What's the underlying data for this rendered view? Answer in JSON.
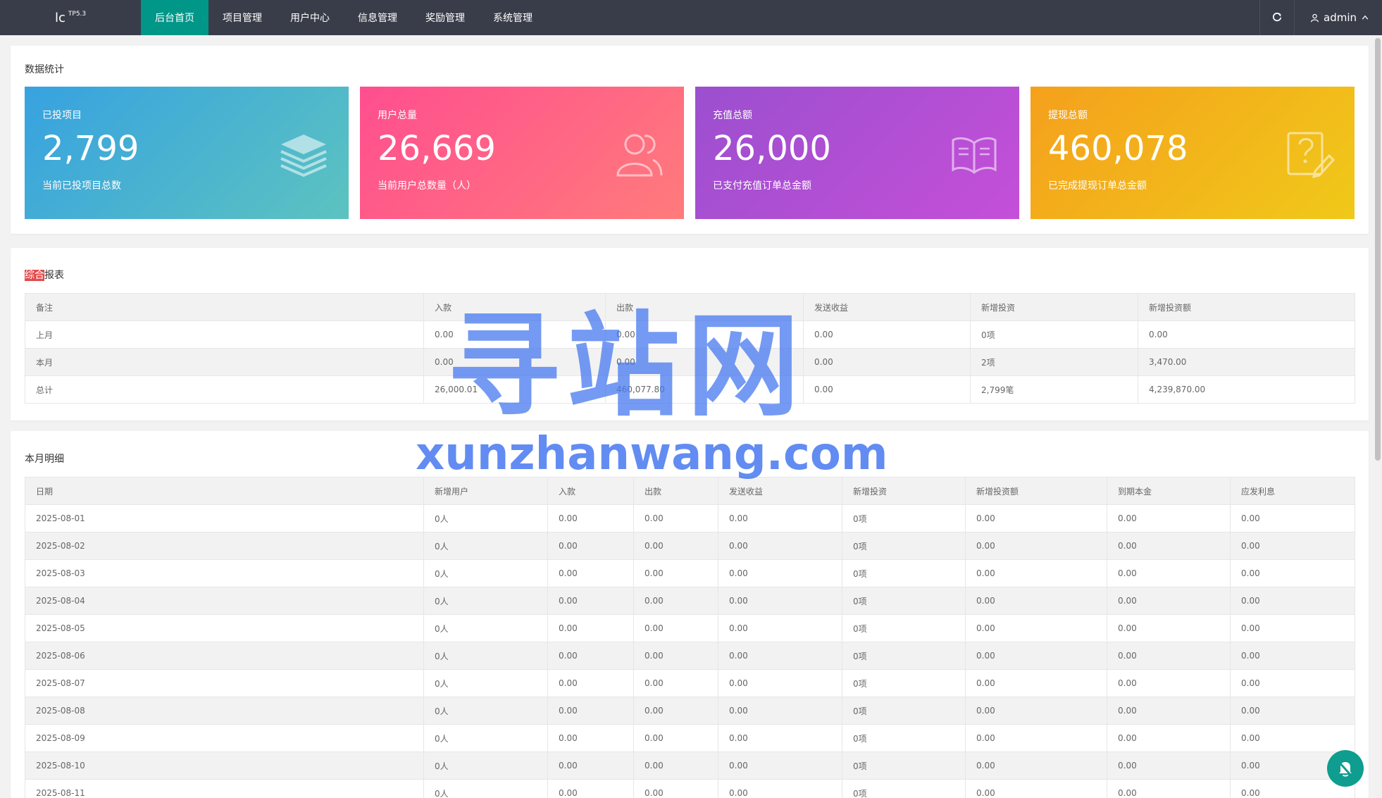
{
  "header": {
    "logo": "lc",
    "logo_sup": "TP5.3",
    "nav": [
      "后台首页",
      "项目管理",
      "用户中心",
      "信息管理",
      "奖励管理",
      "系统管理"
    ],
    "user": "admin"
  },
  "stats": {
    "title": "数据统计",
    "cards": [
      {
        "label": "已投项目",
        "value": "2,799",
        "desc": "当前已投项目总数",
        "icon": "layers-icon"
      },
      {
        "label": "用户总量",
        "value": "26,669",
        "desc": "当前用户总数量（人）",
        "icon": "users-icon"
      },
      {
        "label": "充值总额",
        "value": "26,000",
        "desc": "已支付充值订单总金额",
        "icon": "book-icon"
      },
      {
        "label": "提现总额",
        "value": "460,078",
        "desc": "已完成提现订单总金额",
        "icon": "question-edit-icon"
      }
    ]
  },
  "report": {
    "title_highlight": "综合",
    "title_rest": "报表",
    "headers": [
      "备注",
      "入款",
      "出款",
      "发送收益",
      "新增投资",
      "新增投资额"
    ],
    "rows": [
      [
        "上月",
        "0.00",
        "0.00",
        "0.00",
        "0项",
        "0.00"
      ],
      [
        "本月",
        "0.00",
        "0.00",
        "0.00",
        "2项",
        "3,470.00"
      ],
      [
        "总计",
        "26,000.01",
        "460,077.80",
        "0.00",
        "2,799笔",
        "4,239,870.00"
      ]
    ]
  },
  "monthly": {
    "title": "本月明细",
    "headers": [
      "日期",
      "新增用户",
      "入款",
      "出款",
      "发送收益",
      "新增投资",
      "新增投资额",
      "到期本金",
      "应发利息"
    ],
    "rows": [
      [
        "2025-08-01",
        "0人",
        "0.00",
        "0.00",
        "0.00",
        "0项",
        "0.00",
        "0.00",
        "0.00"
      ],
      [
        "2025-08-02",
        "0人",
        "0.00",
        "0.00",
        "0.00",
        "0项",
        "0.00",
        "0.00",
        "0.00"
      ],
      [
        "2025-08-03",
        "0人",
        "0.00",
        "0.00",
        "0.00",
        "0项",
        "0.00",
        "0.00",
        "0.00"
      ],
      [
        "2025-08-04",
        "0人",
        "0.00",
        "0.00",
        "0.00",
        "0项",
        "0.00",
        "0.00",
        "0.00"
      ],
      [
        "2025-08-05",
        "0人",
        "0.00",
        "0.00",
        "0.00",
        "0项",
        "0.00",
        "0.00",
        "0.00"
      ],
      [
        "2025-08-06",
        "0人",
        "0.00",
        "0.00",
        "0.00",
        "0项",
        "0.00",
        "0.00",
        "0.00"
      ],
      [
        "2025-08-07",
        "0人",
        "0.00",
        "0.00",
        "0.00",
        "0项",
        "0.00",
        "0.00",
        "0.00"
      ],
      [
        "2025-08-08",
        "0人",
        "0.00",
        "0.00",
        "0.00",
        "0项",
        "0.00",
        "0.00",
        "0.00"
      ],
      [
        "2025-08-09",
        "0人",
        "0.00",
        "0.00",
        "0.00",
        "0项",
        "0.00",
        "0.00",
        "0.00"
      ],
      [
        "2025-08-10",
        "0人",
        "0.00",
        "0.00",
        "0.00",
        "0项",
        "0.00",
        "0.00",
        "0.00"
      ],
      [
        "2025-08-11",
        "0人",
        "0.00",
        "0.00",
        "0.00",
        "0项",
        "0.00",
        "0.00",
        "0.00"
      ]
    ]
  },
  "watermark": {
    "big": "寻站网",
    "small": "xunzhanwang.com"
  }
}
